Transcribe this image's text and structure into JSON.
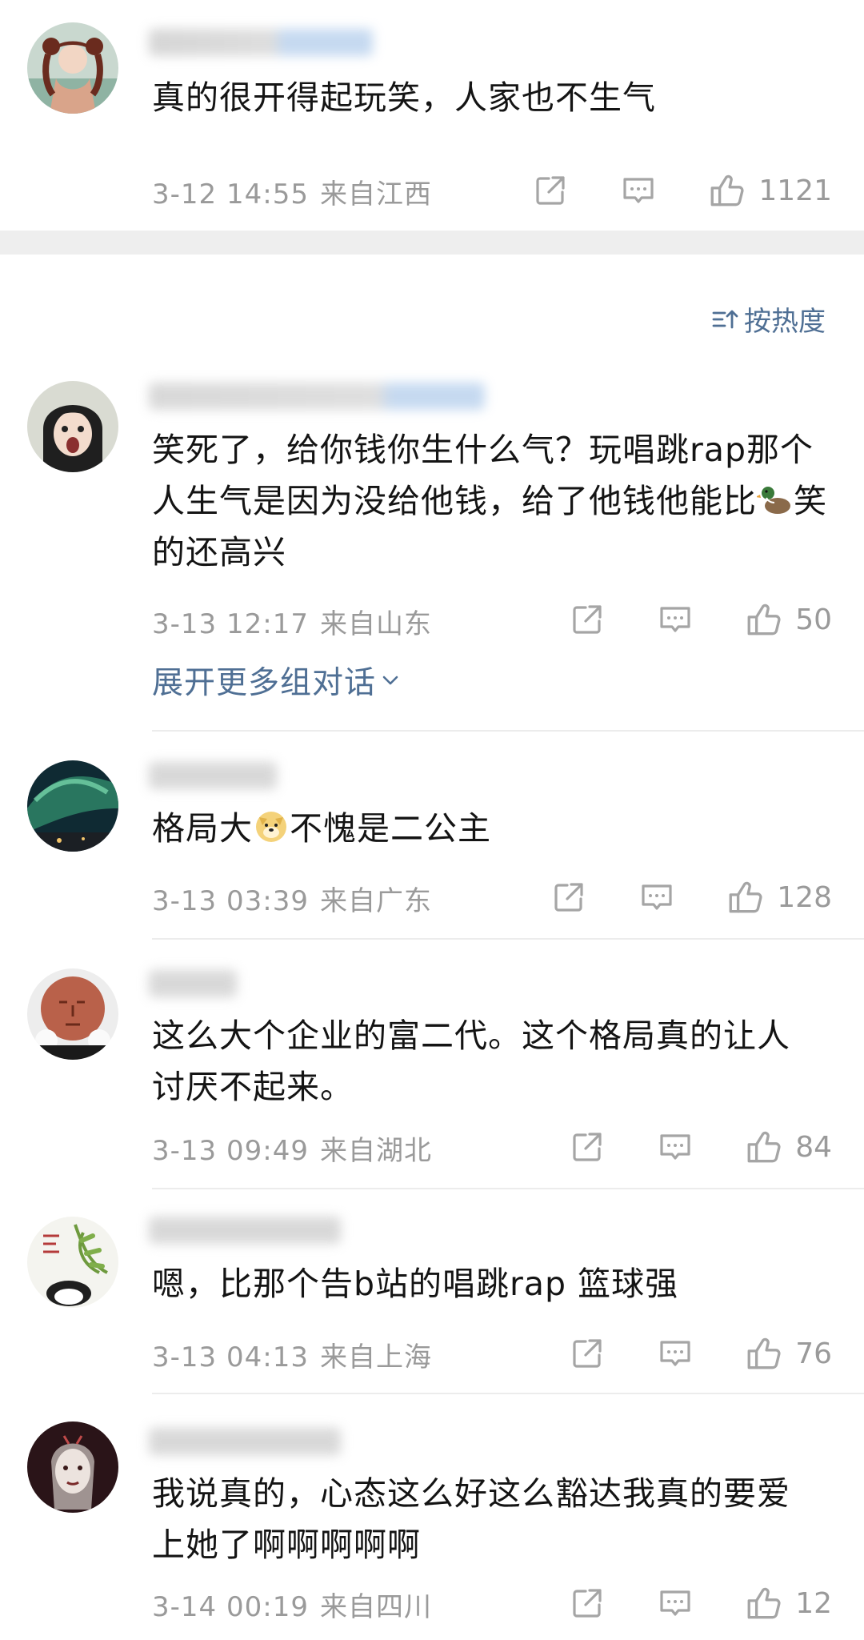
{
  "sort_label": "按热度",
  "expand_label": "展开更多组对话",
  "comments": [
    {
      "text": "真的很开得起玩笑，人家也不生气",
      "date": "3-12 14:55",
      "location": "来自江西",
      "likes": "1121"
    },
    {
      "text_a": "笑死了，给你钱你生什么气？玩唱跳rap那个人生气是因为没给他钱，给了他钱他能比",
      "text_b": "笑的还高兴",
      "emoji": "duck-emoji",
      "date": "3-13 12:17",
      "location": "来自山东",
      "likes": "50"
    },
    {
      "text_a": "格局大",
      "text_b": "不愧是二公主",
      "emoji": "doge-emoji",
      "date": "3-13 03:39",
      "location": "来自广东",
      "likes": "128"
    },
    {
      "text": "这么大个企业的富二代。这个格局真的让人讨厌不起来。",
      "date": "3-13 09:49",
      "location": "来自湖北",
      "likes": "84"
    },
    {
      "text": "嗯，比那个告b站的唱跳rap 篮球强",
      "date": "3-13 04:13",
      "location": "来自上海",
      "likes": "76"
    },
    {
      "text": "我说真的，心态这么好这么豁达我真的要爱上她了啊啊啊啊啊",
      "date": "3-14 00:19",
      "location": "来自四川",
      "likes": "12"
    }
  ],
  "icons": {
    "share": "share-icon",
    "reply": "comment-icon",
    "like": "thumbs-up-icon",
    "sort": "sort-icon",
    "expand": "chevron-down-icon"
  },
  "colors": {
    "link_blue": "#4f6f94",
    "meta_gray": "#9a9a9a",
    "separator": "#eeeeee"
  }
}
